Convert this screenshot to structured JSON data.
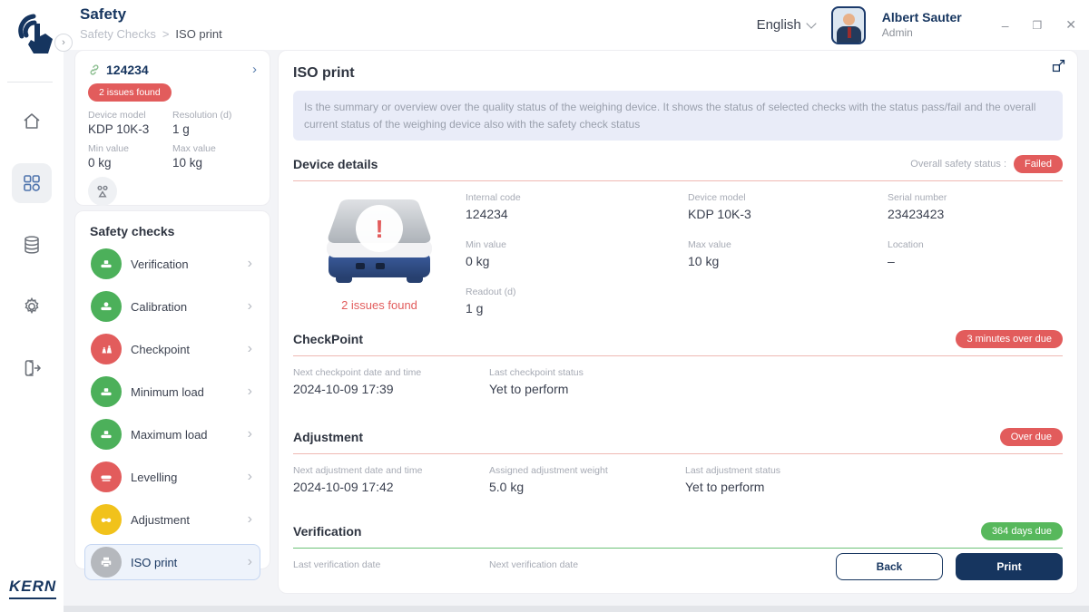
{
  "colors": {
    "navy": "#16355f",
    "red": "#e25c5c",
    "green": "#4cb05a",
    "yellow": "#f1c21b",
    "gray": "#b5b8bd"
  },
  "header": {
    "title": "Safety",
    "breadcrumb": {
      "parent": "Safety Checks",
      "separator": ">",
      "current": "ISO print"
    },
    "language": "English",
    "user": {
      "name": "Albert Sauter",
      "role": "Admin"
    },
    "window_controls": {
      "minimize": "–",
      "maximize": "❐",
      "close": "✕"
    }
  },
  "sidebar": {
    "brand": "KERN",
    "active_item": "dashboard",
    "items": [
      "home-icon",
      "dashboard-icon",
      "database-icon",
      "settings-icon",
      "logout-icon"
    ]
  },
  "device_card": {
    "id": "124234",
    "issues_badge": "2 issues found",
    "chevron": "›",
    "fields": [
      {
        "label": "Device model",
        "value": "KDP 10K-3"
      },
      {
        "label": "Resolution (d)",
        "value": "1 g"
      },
      {
        "label": "Min value",
        "value": "0 kg"
      },
      {
        "label": "Max value",
        "value": "10 kg"
      }
    ]
  },
  "safety_checks": {
    "title": "Safety checks",
    "chevron": "›",
    "items": [
      {
        "label": "Verification",
        "status_color": "green",
        "icon": "scale-icon"
      },
      {
        "label": "Calibration",
        "status_color": "green",
        "icon": "calibration-icon"
      },
      {
        "label": "Checkpoint",
        "status_color": "red",
        "icon": "weights-icon"
      },
      {
        "label": "Minimum load",
        "status_color": "green",
        "icon": "scale-icon"
      },
      {
        "label": "Maximum load",
        "status_color": "green",
        "icon": "scale-icon"
      },
      {
        "label": "Levelling",
        "status_color": "red",
        "icon": "level-icon"
      },
      {
        "label": "Adjustment",
        "status_color": "yellow",
        "icon": "adjust-icon"
      },
      {
        "label": "ISO print",
        "status_color": "gray",
        "icon": "printer-icon",
        "selected": true
      }
    ]
  },
  "main": {
    "title": "ISO print",
    "description": "Is the summary or overview over the quality status of the weighing device. It shows the status of selected checks with the status pass/fail and the overall current status of the weighing device also with the safety check status",
    "device_details": {
      "title": "Device details",
      "overall_status_label": "Overall safety status :",
      "overall_status": "Failed",
      "image_caption": "2 issues found",
      "fields": [
        {
          "label": "Internal code",
          "value": "124234"
        },
        {
          "label": "Device model",
          "value": "KDP 10K-3"
        },
        {
          "label": "Serial number",
          "value": "23423423"
        },
        {
          "label": "Min value",
          "value": "0 kg"
        },
        {
          "label": "Max value",
          "value": "10 kg"
        },
        {
          "label": "Location",
          "value": "–"
        },
        {
          "label": "Readout (d)",
          "value": "1 g"
        }
      ]
    },
    "checkpoint": {
      "title": "CheckPoint",
      "badge": "3 minutes over due",
      "fields": [
        {
          "label": "Next checkpoint date and time",
          "value": "2024-10-09 17:39"
        },
        {
          "label": "Last checkpoint status",
          "value": "Yet to perform"
        }
      ]
    },
    "adjustment": {
      "title": "Adjustment",
      "badge": "Over due",
      "fields": [
        {
          "label": "Next adjustment date and time",
          "value": "2024-10-09 17:42"
        },
        {
          "label": "Assigned adjustment weight",
          "value": "5.0 kg"
        },
        {
          "label": "Last adjustment status",
          "value": "Yet to perform"
        }
      ]
    },
    "verification": {
      "title": "Verification",
      "badge": "364 days due",
      "fields": [
        {
          "label": "Last verification date",
          "value": ""
        },
        {
          "label": "Next verification date",
          "value": ""
        }
      ]
    },
    "buttons": {
      "back": "Back",
      "print": "Print"
    }
  }
}
